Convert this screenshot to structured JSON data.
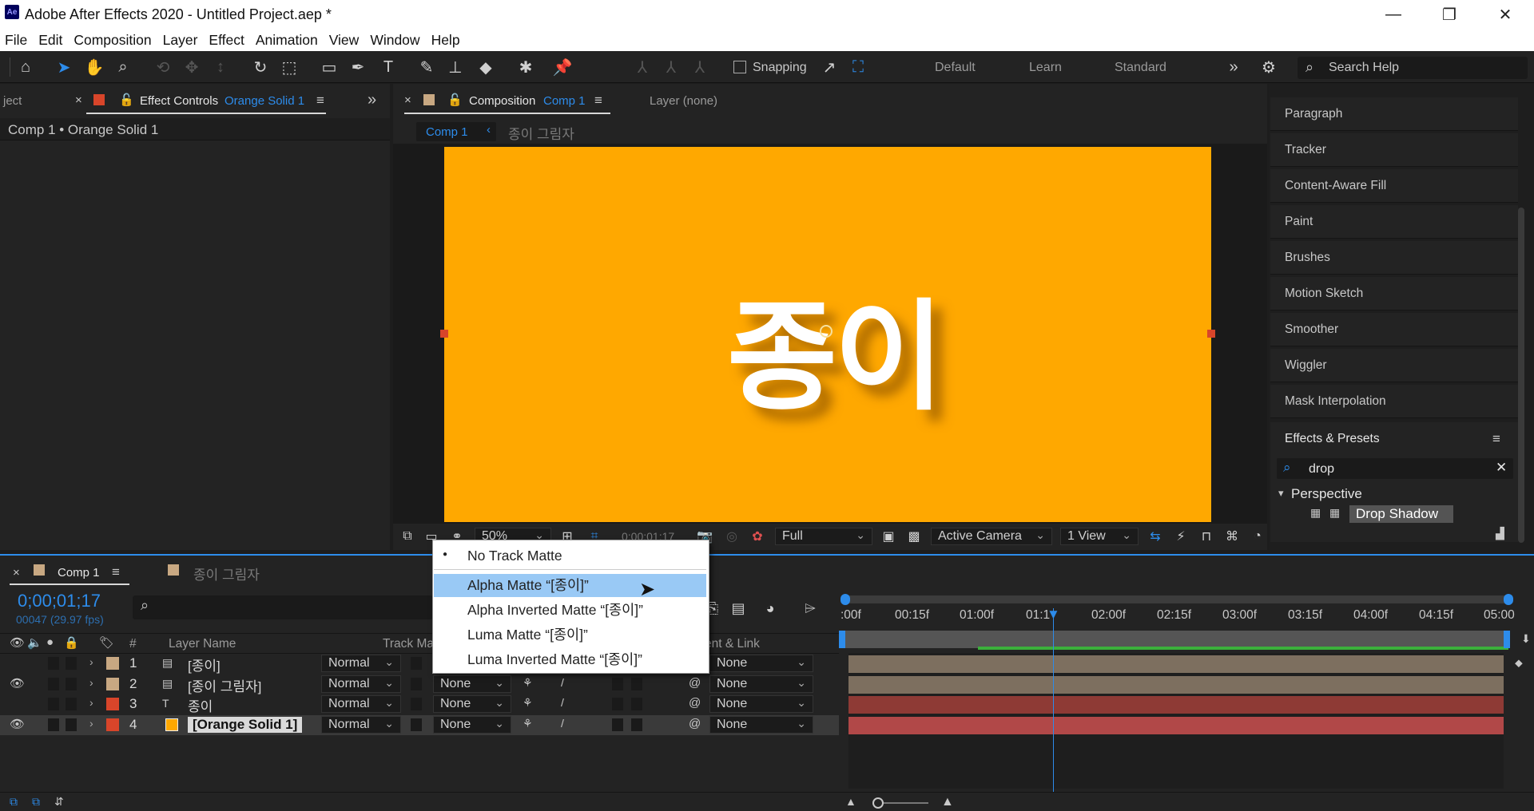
{
  "window": {
    "title": "Adobe After Effects 2020 - Untitled Project.aep *",
    "app_icon": "Ae",
    "controls": [
      "—",
      "❐",
      "✕"
    ]
  },
  "menu": [
    "File",
    "Edit",
    "Composition",
    "Layer",
    "Effect",
    "Animation",
    "View",
    "Window",
    "Help"
  ],
  "toolbar": {
    "snapping_label": "Snapping",
    "workspaces": [
      "Default",
      "Learn",
      "Standard"
    ],
    "search_help_placeholder": "Search Help"
  },
  "project_panel": {
    "tab_project_partial": "ject",
    "effect_controls_tab": "Effect Controls",
    "effect_controls_target": "Orange Solid 1",
    "header": "Comp 1 • Orange Solid 1"
  },
  "composition_panel": {
    "tab_label": "Composition",
    "tab_comp": "Comp 1",
    "layer_tab": "Layer (none)",
    "breadcrumb_active": "Comp 1",
    "breadcrumb_next": "종이 그림자",
    "comp_text": "종이",
    "zoom": "50%",
    "timecode": "0;00;01;17",
    "resolution": "Full",
    "camera": "Active Camera",
    "views": "1 View"
  },
  "right_panels": {
    "items": [
      "Paragraph",
      "Tracker",
      "Content-Aware Fill",
      "Paint",
      "Brushes",
      "Motion Sketch",
      "Smoother",
      "Wiggler",
      "Mask Interpolation"
    ],
    "effects_presets_title": "Effects & Presets",
    "search_value": "drop",
    "category": "Perspective",
    "effect_item": "Drop Shadow"
  },
  "timeline": {
    "tab_active": "Comp 1",
    "tab_other": "종이 그림자",
    "timecode": "0;00;01;17",
    "frame_info": "00047 (29.97 fps)",
    "columns": {
      "number": "#",
      "layer_name": "Layer Name",
      "track_matte": "Track Ma",
      "parent": "ent & Link"
    },
    "ruler": [
      ":00f",
      "00:15f",
      "01:00f",
      "01:1",
      "02:00f",
      "02:15f",
      "03:00f",
      "03:15f",
      "04:00f",
      "04:15f",
      "05:00"
    ],
    "layers": [
      {
        "num": "1",
        "name": "[종이]",
        "mode": "Normal",
        "matte": "",
        "parent": "None",
        "color": "#c8a882",
        "bar": "#7d6f5f",
        "visible": false
      },
      {
        "num": "2",
        "name": "[종이 그림자]",
        "mode": "Normal",
        "matte": "None",
        "parent": "None",
        "color": "#c8a882",
        "bar": "#7d6f5f",
        "visible": true
      },
      {
        "num": "3",
        "name": "종이",
        "mode": "Normal",
        "matte": "None",
        "parent": "None",
        "color": "#d8452a",
        "bar": "#8e3a35",
        "visible": false
      },
      {
        "num": "4",
        "name": "[Orange Solid 1]",
        "mode": "Normal",
        "matte": "None",
        "parent": "None",
        "color": "#d8452a",
        "bar": "#b14848",
        "visible": true
      }
    ]
  },
  "track_matte_menu": {
    "items": [
      {
        "label": "No Track Matte",
        "checked": true,
        "highlighted": false
      },
      {
        "label": "Alpha Matte “[종이]”",
        "checked": false,
        "highlighted": true
      },
      {
        "label": "Alpha Inverted Matte “[종이]”",
        "checked": false,
        "highlighted": false
      },
      {
        "label": "Luma Matte “[종이]”",
        "checked": false,
        "highlighted": false
      },
      {
        "label": "Luma Inverted Matte “[종이]”",
        "checked": false,
        "highlighted": false
      }
    ]
  }
}
